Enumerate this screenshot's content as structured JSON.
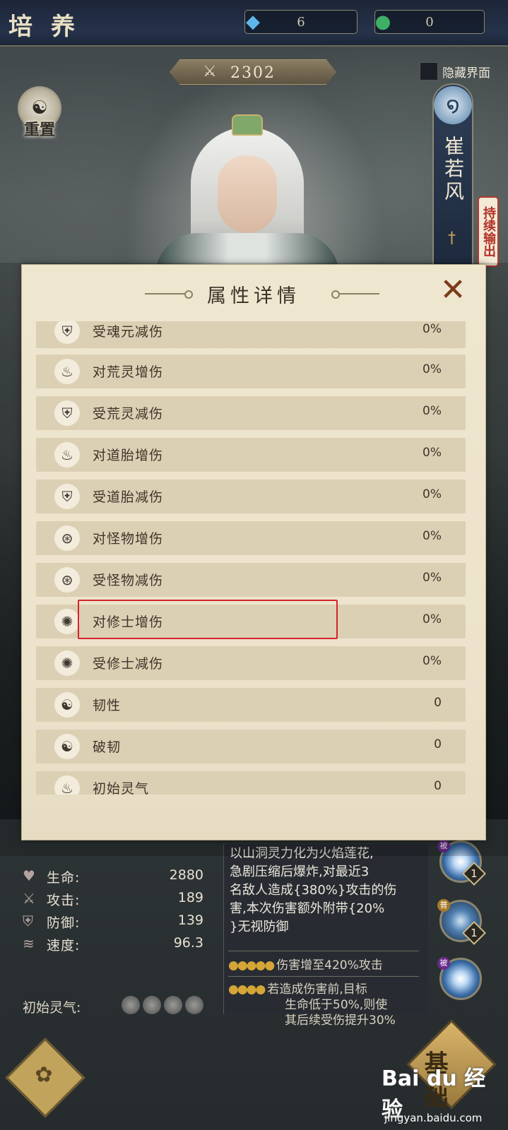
{
  "header": {
    "title": "培养",
    "currency_gem": "6",
    "currency_jade": "0",
    "combat_power": "2302",
    "hide_ui_label": "隐藏界面",
    "reset_label": "重置"
  },
  "hero": {
    "name": "崔若风",
    "status": "持续输出"
  },
  "modal": {
    "title": "属性详情",
    "close_icon": "close-x-icon",
    "rows": [
      {
        "label": "受魂元减伤",
        "value": "0%",
        "icon": "shield-icon"
      },
      {
        "label": "对荒灵增伤",
        "value": "0%",
        "icon": "flame-icon"
      },
      {
        "label": "受荒灵减伤",
        "value": "0%",
        "icon": "shield-icon"
      },
      {
        "label": "对道胎增伤",
        "value": "0%",
        "icon": "flame-icon"
      },
      {
        "label": "受道胎减伤",
        "value": "0%",
        "icon": "shield-icon"
      },
      {
        "label": "对怪物增伤",
        "value": "0%",
        "icon": "swirl-icon"
      },
      {
        "label": "受怪物减伤",
        "value": "0%",
        "icon": "swirl-icon"
      },
      {
        "label": "对修士增伤",
        "value": "0%",
        "icon": "vortex-icon"
      },
      {
        "label": "受修士减伤",
        "value": "0%",
        "icon": "vortex-icon"
      },
      {
        "label": "韧性",
        "value": "0",
        "icon": "yinyang-icon"
      },
      {
        "label": "破韧",
        "value": "0",
        "icon": "yinyang-broken-icon"
      },
      {
        "label": "初始灵气",
        "value": "0",
        "icon": "spirit-flame-icon"
      }
    ]
  },
  "stats": [
    {
      "label": "生命:",
      "value": "2880",
      "icon": "heart-icon"
    },
    {
      "label": "攻击:",
      "value": "189",
      "icon": "sword-icon"
    },
    {
      "label": "防御:",
      "value": "139",
      "icon": "shield-icon"
    },
    {
      "label": "速度:",
      "value": "96.3",
      "icon": "wind-icon"
    }
  ],
  "origin_label": "初始灵气:",
  "skill": {
    "desc_line1": "以山洞灵力化为火焰莲花,",
    "desc_line2": "急剧压缩后爆炸,对最近3",
    "desc_line3": "名敌人造成{380%}攻击的伤",
    "desc_line4": "害,本次伤害额外附带{20%",
    "desc_line5": "}无视防御",
    "upgrade1": "伤害增至420%攻击",
    "upgrade2a": "若造成伤害前,目标",
    "upgrade2b": "生命低于50%,则使",
    "upgrade2c": "其后续受伤提升30%"
  },
  "skill_orbs": [
    {
      "tag": "被",
      "level": "1"
    },
    {
      "tag": "普",
      "level": "1"
    },
    {
      "tag": "被",
      "level": ""
    }
  ],
  "base_button": "基础",
  "watermark": {
    "brand": "Bai du 经验",
    "url": "jingyan.baidu.com"
  }
}
